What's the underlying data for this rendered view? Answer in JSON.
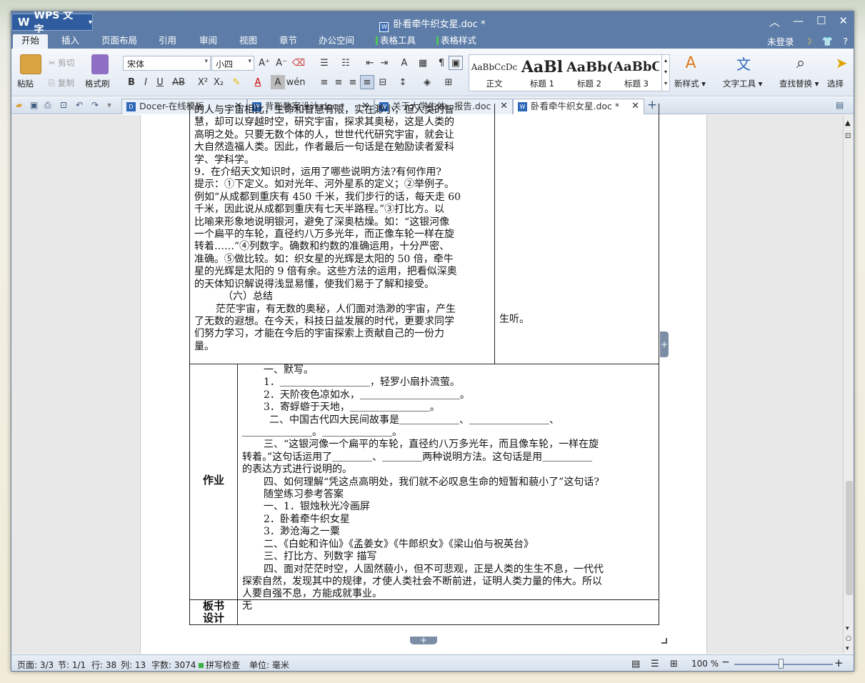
{
  "app": {
    "name": "WPS 文字",
    "doc_title": "卧看牵牛织女星.doc *"
  },
  "menu": {
    "tabs": [
      "开始",
      "插入",
      "页面布局",
      "引用",
      "审阅",
      "视图",
      "章节",
      "办公空间",
      "表格工具",
      "表格样式"
    ],
    "login": "未登录",
    "help": "?"
  },
  "ribbon": {
    "paste": "粘贴",
    "cut": "剪切",
    "copy": "复制",
    "format_painter": "格式刷",
    "font_name": "宋体",
    "font_size": "小四",
    "styles": [
      {
        "preview": "AaBbCcDc",
        "name": "正文"
      },
      {
        "preview": "AaBl",
        "name": "标题 1"
      },
      {
        "preview": "AaBb(",
        "name": "标题 2"
      },
      {
        "preview": "AaBbC",
        "name": "标题 3"
      }
    ],
    "new_style": "新样式",
    "text_tools": "文字工具",
    "find_replace": "查找替换",
    "select": "选择"
  },
  "doc_tabs": [
    {
      "label": "Docer-在线模板"
    },
    {
      "label": "背影教案设计.doc *"
    },
    {
      "label": "关于大学生体...报告.doc"
    },
    {
      "label": "卧看牵牛织女星.doc *"
    }
  ],
  "document": {
    "upper_left_lines": [
      "的人与宇宙相比，生命和智慧有限，实在渺小，但人类的智",
      "慧，却可以穿越时空，研究宇宙，探求其奥秘，这是人类的",
      "高明之处。只要无数个体的人，世世代代研究宇宙，就会让",
      "大自然造福人类。因此，作者最后一句话是在勉励读者爱科",
      "学、学科学。",
      "9．在介绍天文知识时，运用了哪些说明方法?有何作用?",
      "提示：①下定义。如对光年、河外星系的定义；②举例子。",
      "例如“从成都到重庆有 450 千米，我们步行的话，每天走 60",
      "千米，因此说从成都到重庆有七天半路程。”③打比方。以",
      "比喻来形象地说明银河，避免了深奥枯燥。如：“这银河像",
      "一个扁平的车轮，直径约八万多光年，而正像车轮一样在旋",
      "转着……”④列数字。确数和约数的准确运用，十分严密、",
      "准确。⑤做比较。如：织女星的光辉是太阳的 50 倍，牵牛",
      "星的光辉是太阳的 9 倍有余。这些方法的运用，把看似深奥",
      "的天体知识解说得浅显易懂，使我们易于了解和接受。",
      "（六）总结",
      "茫茫宇宙，有无数的奥秘，人们面对浩渺的宇宙，产生",
      "了无数的遐想。在今天，科技日益发展的时代，更要求同学",
      "们努力学习，才能在今后的宇宙探索上贡献自己的一份力",
      "量。"
    ],
    "upper_right": "生听。",
    "homework_label": "作业",
    "homework_lines": [
      "一、默写。",
      "1．＿＿＿＿＿＿＿＿＿，轻罗小扇扑流萤。",
      "2．天阶夜色凉如水，＿＿＿＿＿＿＿＿＿＿。",
      "3．寄蜉蝣于天地，＿＿＿＿＿＿＿＿。",
      "二、中国古代四大民间故事是＿＿＿＿＿＿、＿＿＿＿＿＿＿＿、",
      "＿＿＿＿＿＿＿。＿＿＿＿＿＿＿。",
      "三、“这银河像一个扁平的车轮，直径约八万多光年，而且像车轮，一样在旋",
      "转着。”这句话运用了＿＿＿＿、＿＿＿＿两种说明方法。这句话是用＿＿＿＿＿",
      "的表达方式进行说明的。",
      "四、如何理解“凭这点高明处，我们就不必叹息生命的短暂和藐小了”这句话?",
      "随堂练习参考答案",
      "一、1．银烛秋光冷画屏",
      "2．卧着牵牛织女星",
      "3．渺沧海之一粟",
      "二、《白蛇和许仙》《孟姜女》《牛郎织女》《梁山伯与祝英台》",
      "三、打比方、列数字  描写",
      "四、面对茫茫时空，人固然藐小，但不可悲观，正是人类的生生不息，一代代",
      "探索自然，发现其中的规律，才使人类社会不断前进，证明人类力量的伟大。所以",
      "人要自强不息，方能成就事业。"
    ],
    "board_label_1": "板书",
    "board_label_2": "设计",
    "board_value": "无"
  },
  "status": {
    "page": "页面: 3/3",
    "section": "节: 1/1",
    "row": "行: 38",
    "col": "列: 13",
    "words": "字数: 3074",
    "spell": "拼写检查",
    "unit": "单位: 毫米",
    "zoom": "100 %"
  },
  "colors": {
    "titlebar": "#5d7da8",
    "accent": "#2f5c9e"
  }
}
